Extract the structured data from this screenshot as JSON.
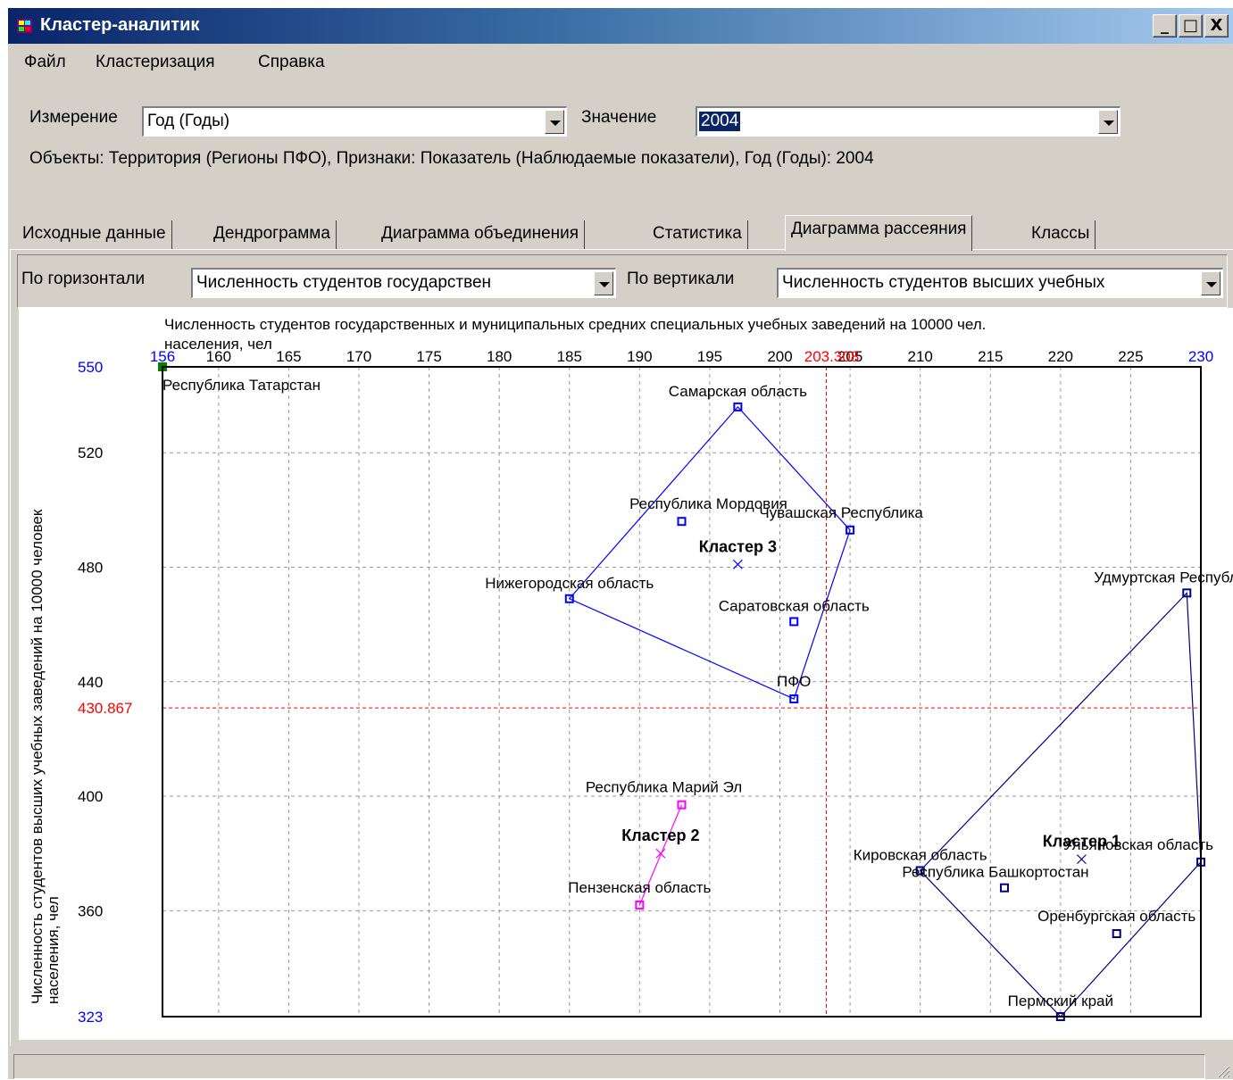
{
  "window": {
    "title": "Кластер-аналитик",
    "minimize": "_",
    "maximize": "□",
    "close": "X"
  },
  "menu": {
    "items": [
      "Файл",
      "Кластеризация",
      "Справка"
    ]
  },
  "params": {
    "dimension_label": "Измерение",
    "dimension_value": "Год (Годы)",
    "value_label": "Значение",
    "value_value": "2004",
    "info": "Объекты: Территория (Регионы ПФО), Признаки: Показатель (Наблюдаемые показатели), Год (Годы): 2004"
  },
  "tabs": [
    "Исходные данные",
    "Дендрограмма",
    "Диаграмма объединения",
    "Статистика",
    "Диаграмма рассеяния",
    "Классы"
  ],
  "active_tab": "Диаграмма рассеяния",
  "axes_select": {
    "horizontal_label": "По горизонтали",
    "horizontal_value": "Численность студентов государствен",
    "vertical_label": "По вертикали",
    "vertical_value": "Численность студентов высших учебных"
  },
  "colors": {
    "accent": "#0000ff",
    "cluster1": "#000080",
    "cluster2": "#ff00ff",
    "cluster3": "#0000ff",
    "mean_line": "#ff0000",
    "first_point": "#008000"
  },
  "chart_data": {
    "type": "scatter",
    "xlabel_line1": "Численность студентов государственных и муниципальных средних специальных учебных заведений на 10000 чел.",
    "xlabel_line2": "населения, чел",
    "ylabel_line1": "Численность студентов высших учебных заведений на 10000 человек",
    "ylabel_line2": "населения, чел",
    "xlim": [
      156,
      230
    ],
    "ylim": [
      323,
      550
    ],
    "x_ticks": [
      160,
      165,
      170,
      175,
      180,
      185,
      190,
      195,
      200,
      205,
      210,
      215,
      220,
      225
    ],
    "y_ticks": [
      360,
      400,
      440,
      480,
      520
    ],
    "x_min_label": "156",
    "x_max_label": "230",
    "y_min_label": "323",
    "y_max_label": "550",
    "x_mean": 203.308,
    "x_mean_label": "203.308",
    "y_mean": 430.867,
    "y_mean_label": "430.867",
    "points": [
      {
        "name": "Республика Татарстан",
        "x": 156,
        "y": 550,
        "cluster": 0
      },
      {
        "name": "Самарская область",
        "x": 197,
        "y": 536,
        "cluster": 3
      },
      {
        "name": "Республика Мордовия",
        "x": 193,
        "y": 496,
        "cluster": 3
      },
      {
        "name": "Чувашская Республика",
        "x": 205,
        "y": 493,
        "cluster": 3
      },
      {
        "name": "Нижегородская область",
        "x": 185,
        "y": 469,
        "cluster": 3
      },
      {
        "name": "Саратовская область",
        "x": 201,
        "y": 461,
        "cluster": 3
      },
      {
        "name": "ПФО",
        "x": 201,
        "y": 434,
        "cluster": 3
      },
      {
        "name": "Удмуртская Республика",
        "x": 229,
        "y": 471,
        "cluster": 1
      },
      {
        "name": "Республика Марий Эл",
        "x": 193,
        "y": 397,
        "cluster": 2
      },
      {
        "name": "Пензенская область",
        "x": 190,
        "y": 362,
        "cluster": 2
      },
      {
        "name": "Кировская область",
        "x": 210,
        "y": 374,
        "cluster": 1
      },
      {
        "name": "Республика Башкортостан",
        "x": 216,
        "y": 368,
        "cluster": 1
      },
      {
        "name": "Ульяновская область",
        "x": 230,
        "y": 377,
        "cluster": 1
      },
      {
        "name": "Оренбургская область",
        "x": 224,
        "y": 352,
        "cluster": 1
      },
      {
        "name": "Пермский край",
        "x": 220,
        "y": 323,
        "cluster": 1
      }
    ],
    "clusters": [
      {
        "name": "Кластер 1",
        "x": 221.5,
        "y": 378,
        "hull": [
          "Удмуртская Республика",
          "Ульяновская область",
          "Пермский край",
          "Кировская область"
        ]
      },
      {
        "name": "Кластер 2",
        "x": 191.5,
        "y": 380,
        "hull": [
          "Республика Марий Эл",
          "Пензенская область"
        ]
      },
      {
        "name": "Кластер 3",
        "x": 197,
        "y": 481,
        "hull": [
          "Самарская область",
          "Чувашская Республика",
          "ПФО",
          "Нижегородская область"
        ]
      }
    ]
  }
}
